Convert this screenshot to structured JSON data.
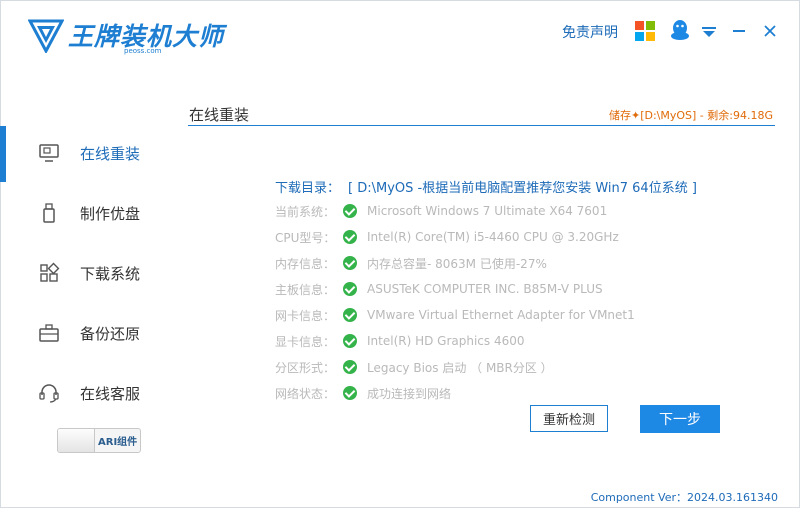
{
  "app": {
    "title": "王牌装机大师",
    "subtitle": "peoss.com",
    "brand_color": "#1e7fd2"
  },
  "header": {
    "disclaimer_label": "免责声明",
    "icons": [
      "windows-logo-icon",
      "qq-penguin-icon",
      "dropdown-menu-icon",
      "minimize-icon",
      "close-icon"
    ]
  },
  "sidebar": {
    "items": [
      {
        "label": "在线重装",
        "icon": "monitor-icon",
        "active": true
      },
      {
        "label": "制作优盘",
        "icon": "usb-drive-icon",
        "active": false
      },
      {
        "label": "下载系统",
        "icon": "grid-apps-icon",
        "active": false
      },
      {
        "label": "备份还原",
        "icon": "briefcase-icon",
        "active": false
      },
      {
        "label": "在线客服",
        "icon": "headset-icon",
        "active": false
      }
    ],
    "toggle_label": "ARI组件"
  },
  "main": {
    "section_title": "在线重装",
    "storage": "储存✦[D:\\MyOS] - 剩余:94.18G",
    "download_label": "下载目录：",
    "download_value": "[ D:\\MyOS -根据当前电脑配置推荐您安装 Win7 64位系统 ]",
    "info_rows": [
      {
        "key": "当前系统：",
        "value": "Microsoft Windows 7 Ultimate X64  7601"
      },
      {
        "key": "CPU型号：",
        "value": "Intel(R) Core(TM) i5-4460  CPU @ 3.20GHz"
      },
      {
        "key": "内存信息：",
        "value": "内存总容量- 8063M  已使用-27%"
      },
      {
        "key": "主板信息：",
        "value": "ASUSTeK COMPUTER INC. B85M-V PLUS"
      },
      {
        "key": "网卡信息：",
        "value": "VMware Virtual Ethernet Adapter for VMnet1"
      },
      {
        "key": "显卡信息：",
        "value": "Intel(R) HD Graphics 4600"
      },
      {
        "key": "分区形式：",
        "value": "Legacy Bios 启动 （ MBR分区 ）"
      },
      {
        "key": "网络状态：",
        "value": "成功连接到网络"
      }
    ],
    "recheck_button": "重新检测",
    "next_button": "下一步",
    "status_color": "#34b34a"
  },
  "footer": {
    "version": "Component Ver：2024.03.161340"
  }
}
